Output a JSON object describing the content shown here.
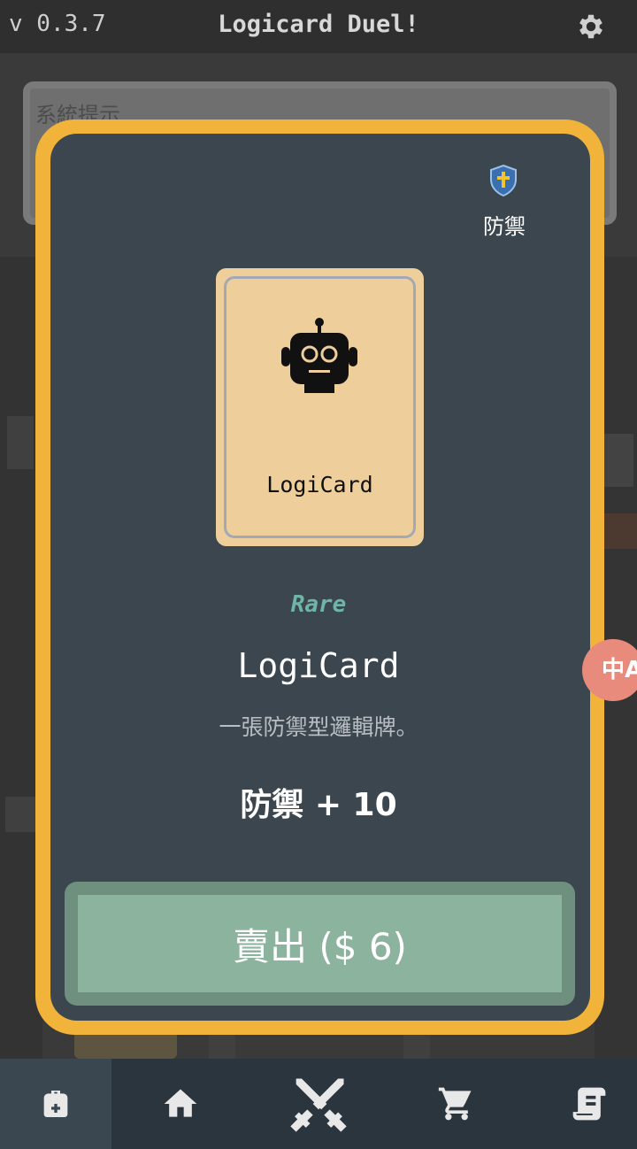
{
  "topbar": {
    "version": "v 0.3.7",
    "title": "Logicard Duel!",
    "settings_icon": "gear-icon"
  },
  "notice": {
    "title": "系統提示"
  },
  "modal": {
    "type_label": "防禦",
    "type_icon": "shield-cross-icon",
    "card_name": "LogiCard",
    "card_icon": "robot-icon",
    "rarity": "Rare",
    "title": "LogiCard",
    "description": "一張防禦型邏輯牌。",
    "effect": "防禦 + 10",
    "sell_label": "賣出 ($ 6)"
  },
  "translate_fab": {
    "label": "中A",
    "icon": "translate-icon"
  },
  "bottom_nav": [
    {
      "icon": "backpack-icon",
      "active": true
    },
    {
      "icon": "home-icon",
      "active": false
    },
    {
      "icon": "crossed-swords-icon",
      "active": false
    },
    {
      "icon": "cart-icon",
      "active": false
    },
    {
      "icon": "scroll-icon",
      "active": false
    }
  ],
  "colors": {
    "modal_border": "#f2b33a",
    "modal_bg": "#3b464e",
    "card_bg": "#eecf9c",
    "rarity": "#6fb5a7",
    "sell_button": "#8cb39d"
  }
}
